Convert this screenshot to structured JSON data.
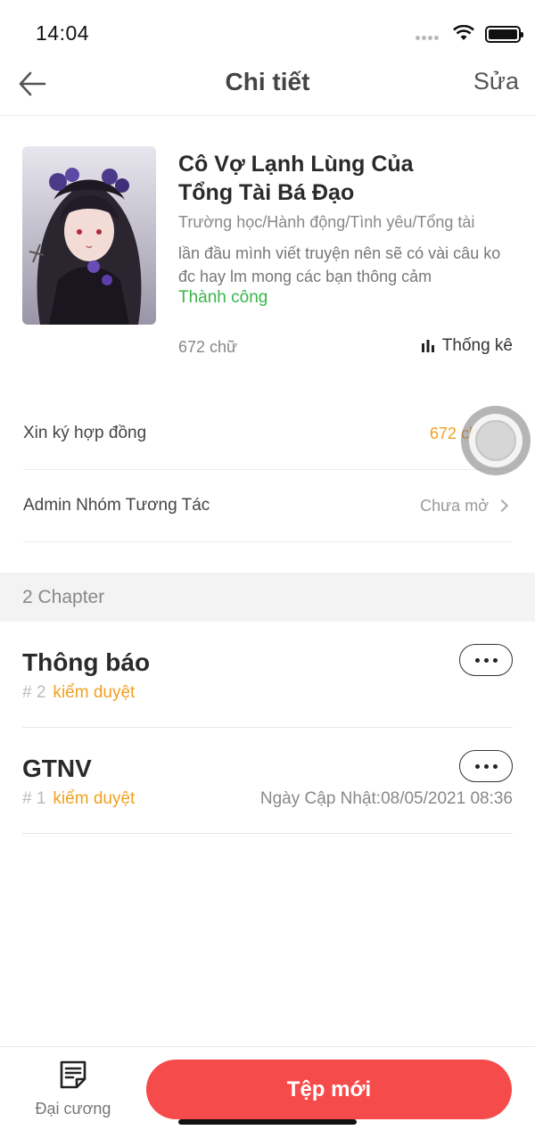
{
  "status_bar": {
    "time": "14:04"
  },
  "nav": {
    "title": "Chi tiết",
    "edit_label": "Sửa"
  },
  "story": {
    "title": "Cô Vợ Lạnh Lùng Của Tổng Tài Bá Đạo",
    "tags": "Trường học/Hành động/Tình yêu/Tổng tài",
    "description": "lần đầu mình viết truyện nên sẽ có vài câu ko đc hay lm mong các bạn thông cảm",
    "status": "Thành công",
    "word_count": "672 chữ",
    "stats_label": "Thống kê"
  },
  "rows": [
    {
      "label": "Xin ký hợp đồng",
      "value": "672 chữ"
    },
    {
      "label": "Admin Nhóm Tương Tác",
      "value": "Chưa mở"
    }
  ],
  "chapters_header": "2 Chapter",
  "chapters": [
    {
      "title": "Thông báo",
      "number": "# 2",
      "status": "kiểm duyệt",
      "date": ""
    },
    {
      "title": "GTNV",
      "number": "# 1",
      "status": "kiểm duyệt",
      "date": "Ngày Cập Nhật:08/05/2021 08:36"
    }
  ],
  "bottom": {
    "outline_label": "Đại cương",
    "new_file_label": "Tệp mới"
  },
  "colors": {
    "accent_red": "#f64b4b",
    "success_green": "#39b54a",
    "warning_orange": "#f0a020"
  }
}
